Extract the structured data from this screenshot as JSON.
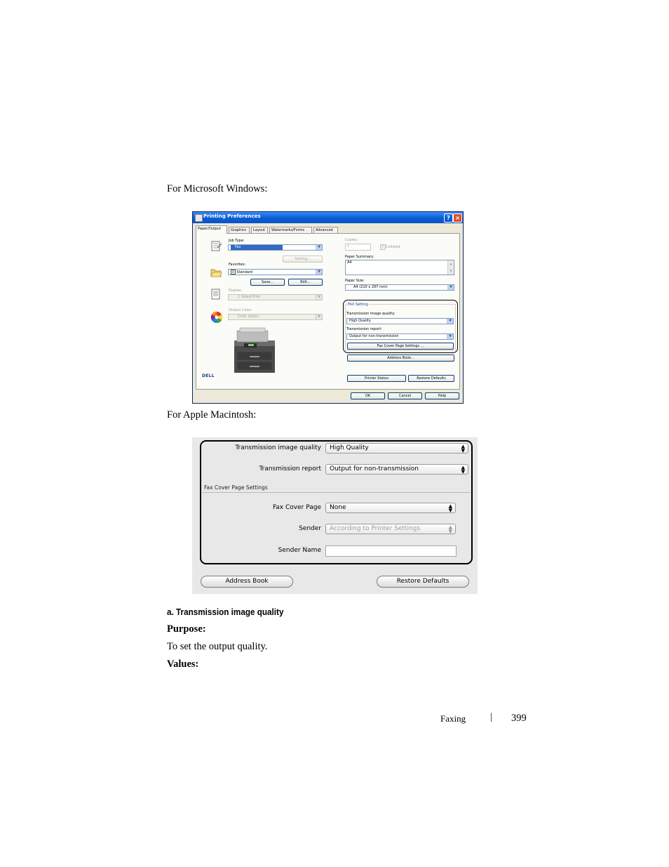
{
  "intro_windows": "For Microsoft Windows:",
  "intro_mac": "For Apple Macintosh:",
  "windows_dialog": {
    "title": "Printing Preferences",
    "help_glyph": "?",
    "close_glyph": "×",
    "tabs": [
      "Paper/Output",
      "Graphics",
      "Layout",
      "Watermarks/Forms",
      "Advanced"
    ],
    "job_type_label": "Job Type:",
    "job_type_value": "Fax",
    "setting_button": "Setting...",
    "favorites_label": "Favorites:",
    "favorites_value": "Standard",
    "favorites_badge": "A",
    "save_button": "Save...",
    "edit_button": "Edit...",
    "duplex_label": "Duplex:",
    "duplex_value": "1 Sided Print",
    "output_color_label": "Output Color:",
    "output_color_value": "Color (Auto)",
    "copies_label": "Copies:",
    "copies_value": "1",
    "collated_label": "Collated",
    "paper_summary_label": "Paper Summary:",
    "paper_summary_value": "A4",
    "paper_size_label": "Paper Size:",
    "paper_size_value": "A4 (210 x 297 mm)",
    "fax_setting_group": "FAX Setting",
    "transmission_quality_label": "Transmission image quality:",
    "transmission_quality_value": "High Quality",
    "transmission_report_label": "Transmission report:",
    "transmission_report_value": "Output for non-transmission",
    "fax_cover_button": "Fax Cover Page Settings ...",
    "address_book_button": "Address Book...",
    "printer_status_button": "Printer Status",
    "restore_defaults_button": "Restore Defaults",
    "brand": "DELL",
    "ok_button": "OK",
    "cancel_button": "Cancel",
    "help_button": "Help"
  },
  "mac_dialog": {
    "transmission_quality_label": "Transmission image quality",
    "transmission_quality_value": "High Quality",
    "transmission_report_label": "Transmission report",
    "transmission_report_value": "Output for non-transmission",
    "cover_section_title": "Fax Cover Page Settings",
    "fax_cover_label": "Fax Cover Page",
    "fax_cover_value": "None",
    "sender_label": "Sender",
    "sender_value": "According to Printer Settings",
    "sender_name_label": "Sender Name",
    "sender_name_value": "",
    "address_book_button": "Address Book",
    "restore_defaults_button": "Restore Defaults"
  },
  "section_heading": "a. Transmission image quality",
  "purpose_label": "Purpose:",
  "purpose_text": "To set the output quality.",
  "values_label": "Values:",
  "footer": {
    "section": "Faxing",
    "separator": "|",
    "page_number": "399"
  },
  "colors": {
    "xp_title_blue": "#0a5fd8",
    "xp_face": "#ece9d8",
    "highlight": "#316ac5",
    "mac_bg": "#e8e8e8"
  }
}
